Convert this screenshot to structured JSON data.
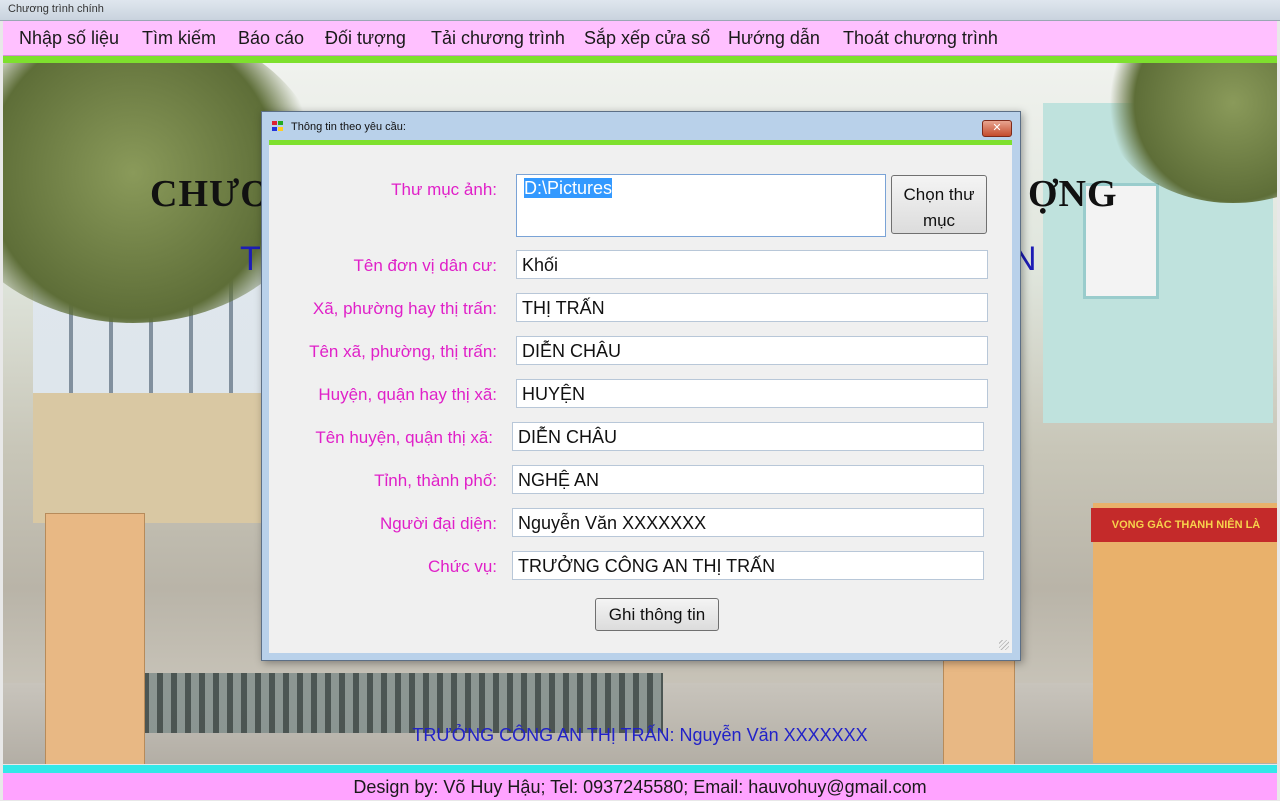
{
  "window": {
    "title": "Chương trình chính"
  },
  "menu": {
    "items": [
      {
        "label": "Nhập số liệu"
      },
      {
        "label": "Tìm kiếm"
      },
      {
        "label": "Báo cáo"
      },
      {
        "label": "Đối tượng"
      },
      {
        "label": "Tải chương trình"
      },
      {
        "label": "Sắp xếp cửa sổ"
      },
      {
        "label": "Hướng dẫn"
      },
      {
        "label": "Thoát chương trình"
      }
    ]
  },
  "background": {
    "title_left": "CHƯƠ",
    "title_right": "ỢNG",
    "subtitle_left": "T",
    "subtitle_right": "N",
    "official_line": "TRƯỞNG CÔNG AN THỊ TRẤN: Nguyễn Văn XXXXXXX",
    "sign_text": "VỌNG GÁC THANH NIÊN LÀ"
  },
  "dialog": {
    "title": "Thông tin theo yêu cầu:",
    "close_label": "✕",
    "folder": {
      "label": "Thư mục ảnh:",
      "value": "D:\\Pictures",
      "button_label_line1": "Chọn thư",
      "button_label_line2": "mục"
    },
    "fields": [
      {
        "label": "Tên đơn vị dân cư:",
        "value": "Khối"
      },
      {
        "label": "Xã, phường hay thị trấn:",
        "value": "THỊ TRẤN"
      },
      {
        "label": "Tên xã, phường, thị trấn:",
        "value": "DIỄN CHÂU"
      },
      {
        "label": "Huyện, quận hay thị xã:",
        "value": "HUYỆN"
      },
      {
        "label": "Tên huyện, quận thị xã:",
        "value": "DIỄN CHÂU"
      },
      {
        "label": "Tỉnh, thành phố:",
        "value": "NGHỆ AN"
      },
      {
        "label": "Người đại diện:",
        "value": "Nguyễn Văn XXXXXXX"
      },
      {
        "label": "Chức vụ:",
        "value": "TRƯỞNG CÔNG AN THỊ TRẤN"
      }
    ],
    "save_label": "Ghi thông tin"
  },
  "footer": {
    "design_text": "Design by: Võ Huy Hậu; Tel: 0937245580; Email: hauvohuy@gmail.com"
  },
  "colors": {
    "menu_bg": "#ffc0ff",
    "accent_green": "#7ee02e",
    "label_magenta": "#e020c8",
    "footer_bg": "#ffa3ff",
    "cyan_line": "#33e8e8"
  }
}
